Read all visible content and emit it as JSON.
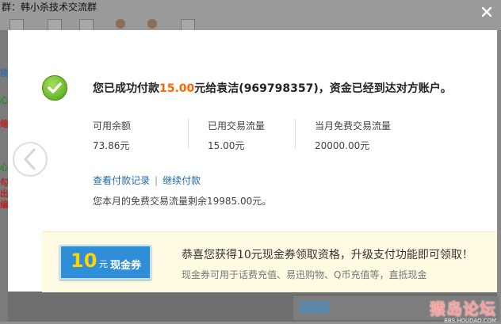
{
  "background": {
    "top_text": "群：韩小杀技术交流群",
    "left_fragments": [
      "楼",
      "心",
      "缩",
      "心",
      "勾",
      "出",
      "编"
    ]
  },
  "watermark": {
    "title": "猴岛论坛",
    "url": "BBS.HOUDAO.COM"
  },
  "modal": {
    "headline": {
      "prefix": "您已成功付款",
      "amount": "15.00",
      "suffix": "元给袁洁(969798357)，资金已经到达对方账户。"
    },
    "stats": [
      {
        "label": "可用余额",
        "value": "73.86元"
      },
      {
        "label": "已用交易流量",
        "value": "15.00元"
      },
      {
        "label": "当月免费交易流量",
        "value": "20000.00元"
      }
    ],
    "links": {
      "view_records": "查看付款记录",
      "separator": "|",
      "continue_pay": "继续付款"
    },
    "remaining_text": "您本月的免费交易流量剩余19985.00元。",
    "promo": {
      "coupon_amount": "10",
      "coupon_unit": "元",
      "coupon_word": "现金券",
      "title": "恭喜您获得10元现金券领取资格，升级支付功能即可领取！",
      "subtitle": "现金券可用于话费充值、易迅购物、Q币充值等，直抵现金"
    }
  },
  "colors": {
    "accent_amount": "#ff6600",
    "link": "#1e6aa8",
    "promo_bg": "#fffbe2"
  }
}
